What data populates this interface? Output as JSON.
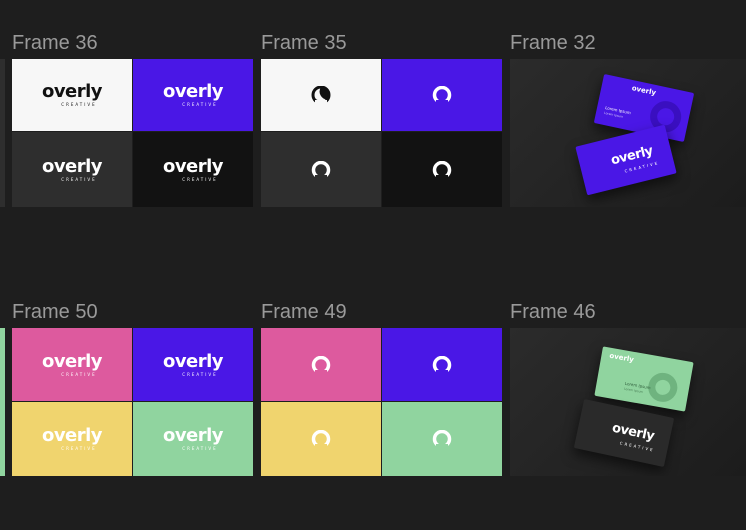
{
  "frames": {
    "f36": {
      "title": "Frame 36"
    },
    "f35": {
      "title": "Frame 35"
    },
    "f32": {
      "title": "Frame 32"
    },
    "f50": {
      "title": "Frame 50"
    },
    "f49": {
      "title": "Frame 49"
    },
    "f46": {
      "title": "Frame 46"
    }
  },
  "brand": {
    "wordmark": "overly",
    "tagline": "CREATIVE",
    "card_name": "Lorem Ipsum",
    "card_role": "Lorem Ipsum"
  },
  "colors": {
    "canvas": "#1e1e1e",
    "white": "#f7f7f7",
    "purple": "#4a17e6",
    "dark_gray": "#2e2e2e",
    "black": "#121212",
    "pink": "#dd5a9e",
    "yellow": "#f0d46e",
    "green": "#90d49f"
  },
  "icons": [
    "overly-o-logo-icon"
  ]
}
